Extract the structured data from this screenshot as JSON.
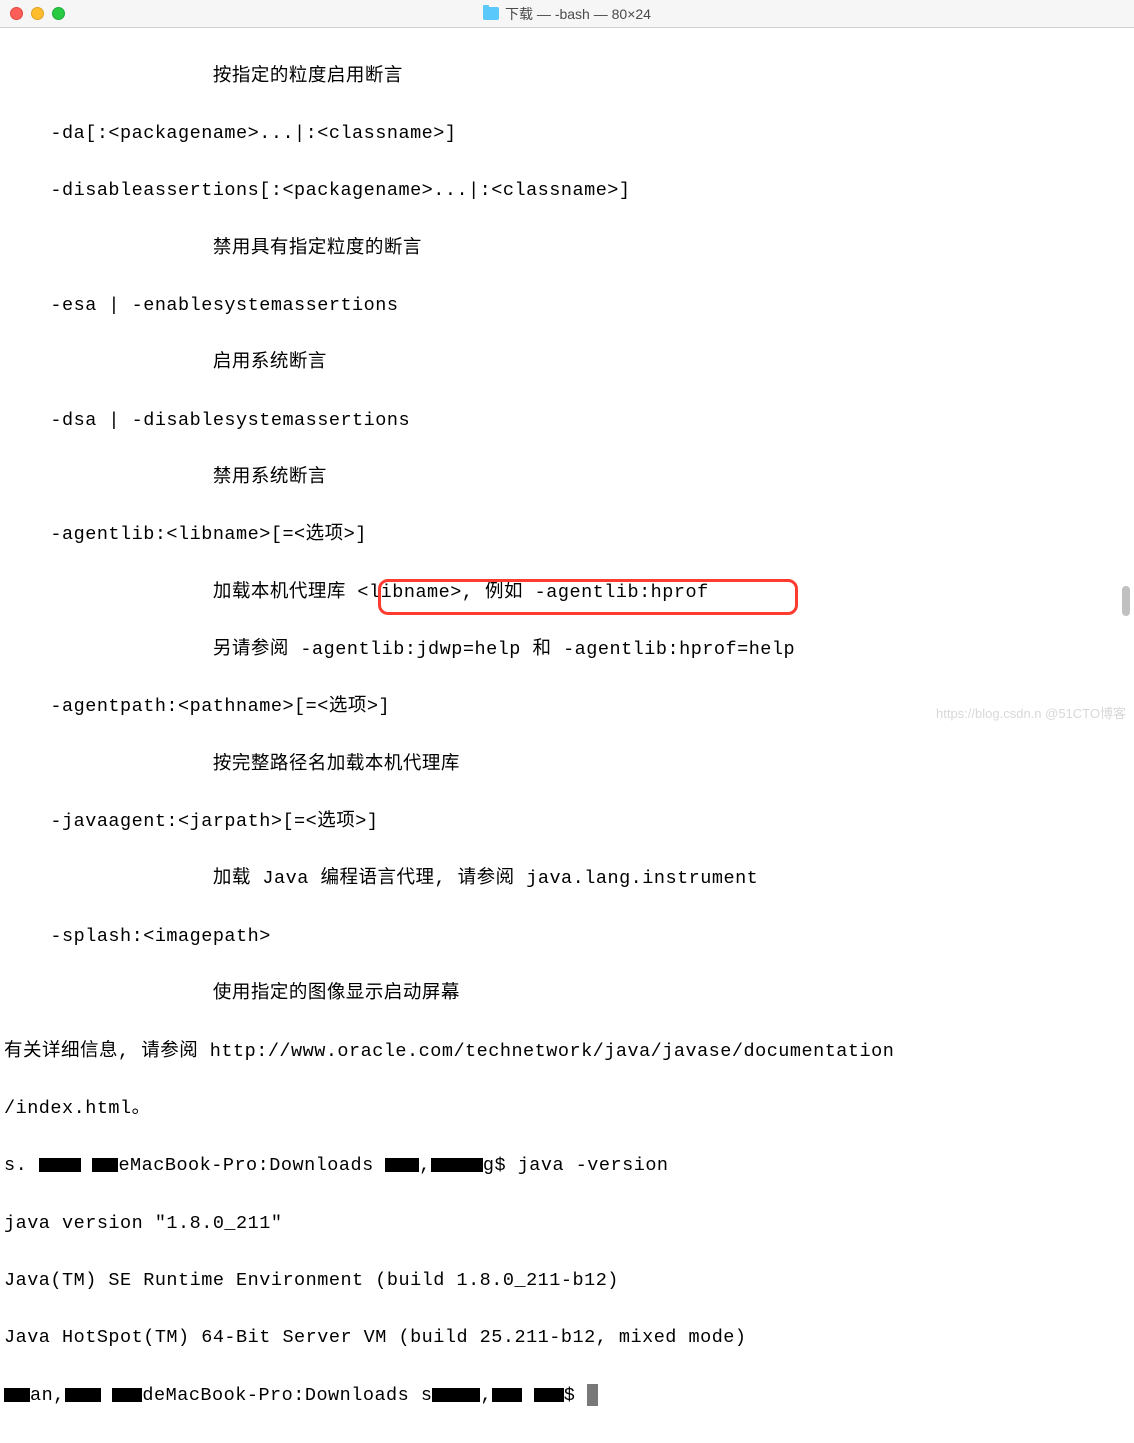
{
  "window": {
    "title": "下载 — -bash — 80×24"
  },
  "terminal": {
    "lines": {
      "l01": "                  按指定的粒度启用断言",
      "l02": "    -da[:<packagename>...|:<classname>]",
      "l03": "    -disableassertions[:<packagename>...|:<classname>]",
      "l04": "                  禁用具有指定粒度的断言",
      "l05": "    -esa | -enablesystemassertions",
      "l06": "                  启用系统断言",
      "l07": "    -dsa | -disablesystemassertions",
      "l08": "                  禁用系统断言",
      "l09": "    -agentlib:<libname>[=<选项>]",
      "l10": "                  加载本机代理库 <libname>, 例如 -agentlib:hprof",
      "l11": "                  另请参阅 -agentlib:jdwp=help 和 -agentlib:hprof=help",
      "l12": "    -agentpath:<pathname>[=<选项>]",
      "l13": "                  按完整路径名加载本机代理库",
      "l14": "    -javaagent:<jarpath>[=<选项>]",
      "l15": "                  加载 Java 编程语言代理, 请参阅 java.lang.instrument",
      "l16": "    -splash:<imagepath>",
      "l17": "                  使用指定的图像显示启动屏幕",
      "l18": "有关详细信息, 请参阅 http://www.oracle.com/technetwork/java/javase/documentation",
      "l19": "/index.html。",
      "prompt1_a": "s.",
      "prompt1_b": "eMacBook-Pro:Downloads ",
      "prompt1_c": "g$ java -version",
      "l21": "java version \"1.8.0_211\"",
      "l22": "Java(TM) SE Runtime Environment (build 1.8.0_211-b12)",
      "l23": "Java HotSpot(TM) 64-Bit Server VM (build 25.211-b12, mixed mode)",
      "prompt2_a": "an,",
      "prompt2_b": "deMacBook-Pro:Downloads s",
      "prompt2_c": "$ "
    }
  },
  "watermark": "https://blog.csdn.n @51CTO博客"
}
